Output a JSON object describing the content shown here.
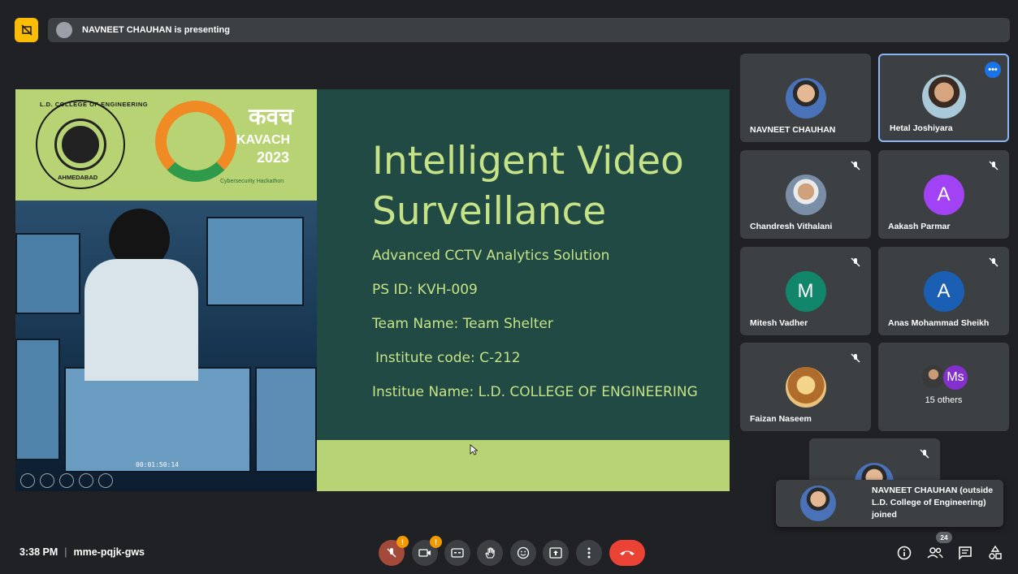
{
  "banner": {
    "presenter_text": "NAVNEET CHAUHAN is presenting",
    "pin_icon": "pin-off-icon"
  },
  "slide": {
    "title": "Intelligent Video Surveillance",
    "subtitle": "Advanced CCTV Analytics Solution",
    "ps_id": "PS ID: KVH-009",
    "team_name": "Team Name: Team Shelter",
    "institute_code": "Institute code: C-212",
    "institute_name": "Institue Name: L.D. COLLEGE OF ENGINEERING",
    "college_logo_top": "L.D. COLLEGE OF ENGINEERING",
    "college_logo_bottom": "AHMEDABAD",
    "kavach_hindi": "कवच",
    "kavach_name": "KAVACH",
    "kavach_year": "2023",
    "kavach_tagline": "Cybersecurity Hackathon",
    "video_timestamp": "00:01:50:14"
  },
  "participants": [
    {
      "name": "NAVNEET CHAUHAN",
      "muted": false
    },
    {
      "name": "Hetal Joshiyara",
      "muted": false,
      "active": true
    },
    {
      "name": "Chandresh Vithalani",
      "muted": true
    },
    {
      "name": "Aakash Parmar",
      "muted": true,
      "initial": "A"
    },
    {
      "name": "Mitesh Vadher",
      "muted": true,
      "initial": "M"
    },
    {
      "name": "Anas Mohammad Sheikh",
      "muted": true,
      "initial": "A"
    },
    {
      "name": "Faizan Naseem",
      "muted": true
    }
  ],
  "others": {
    "label": "15 others",
    "initial": "Ms"
  },
  "toast": {
    "text": "NAVNEET CHAUHAN (outside L.D. College of Engineering) joined"
  },
  "bottom": {
    "time": "3:38 PM",
    "meeting_code": "mme-pqjk-gws",
    "mic_badge": "!",
    "cam_badge": "!",
    "participant_count": "24"
  },
  "colors": {
    "background": "#202124",
    "tile": "#3c4043",
    "hangup": "#ea4335",
    "active_border": "#8ab4f8",
    "aakash_avatar": "#a142f4",
    "mitesh_avatar": "#12866a",
    "anas_avatar": "#1a5fb4",
    "slide_text": "#c6e286"
  }
}
